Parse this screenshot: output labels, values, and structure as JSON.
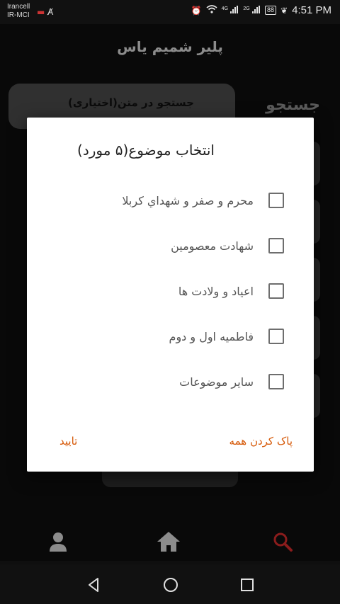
{
  "status_bar": {
    "carrier_1": "Irancell",
    "carrier_2": "IR-MCI",
    "network_1": "4G",
    "network_2": "2G",
    "battery": "88",
    "time": "4:51 PM"
  },
  "app": {
    "title": "پلیر شمیم یاس"
  },
  "background_page": {
    "search_placeholder": "جستجو در متن(اختیاری)",
    "search_label": "جستجو"
  },
  "dialog": {
    "title": "انتخاب موضوع(۵ مورد)",
    "options": [
      {
        "label": "محرم و صفر و شهداي كربلا",
        "checked": false
      },
      {
        "label": "شهادت معصومین",
        "checked": false
      },
      {
        "label": "اعیاد و ولادت ها",
        "checked": false
      },
      {
        "label": "فاطمیه اول و دوم",
        "checked": false
      },
      {
        "label": "سایر موضوعات",
        "checked": false
      }
    ],
    "clear_all_label": "پاک کردن همه",
    "confirm_label": "تایید"
  },
  "colors": {
    "accent": "#d65a0a",
    "search_active": "#8a1c1c",
    "nav_icon": "#8c8c8c"
  }
}
